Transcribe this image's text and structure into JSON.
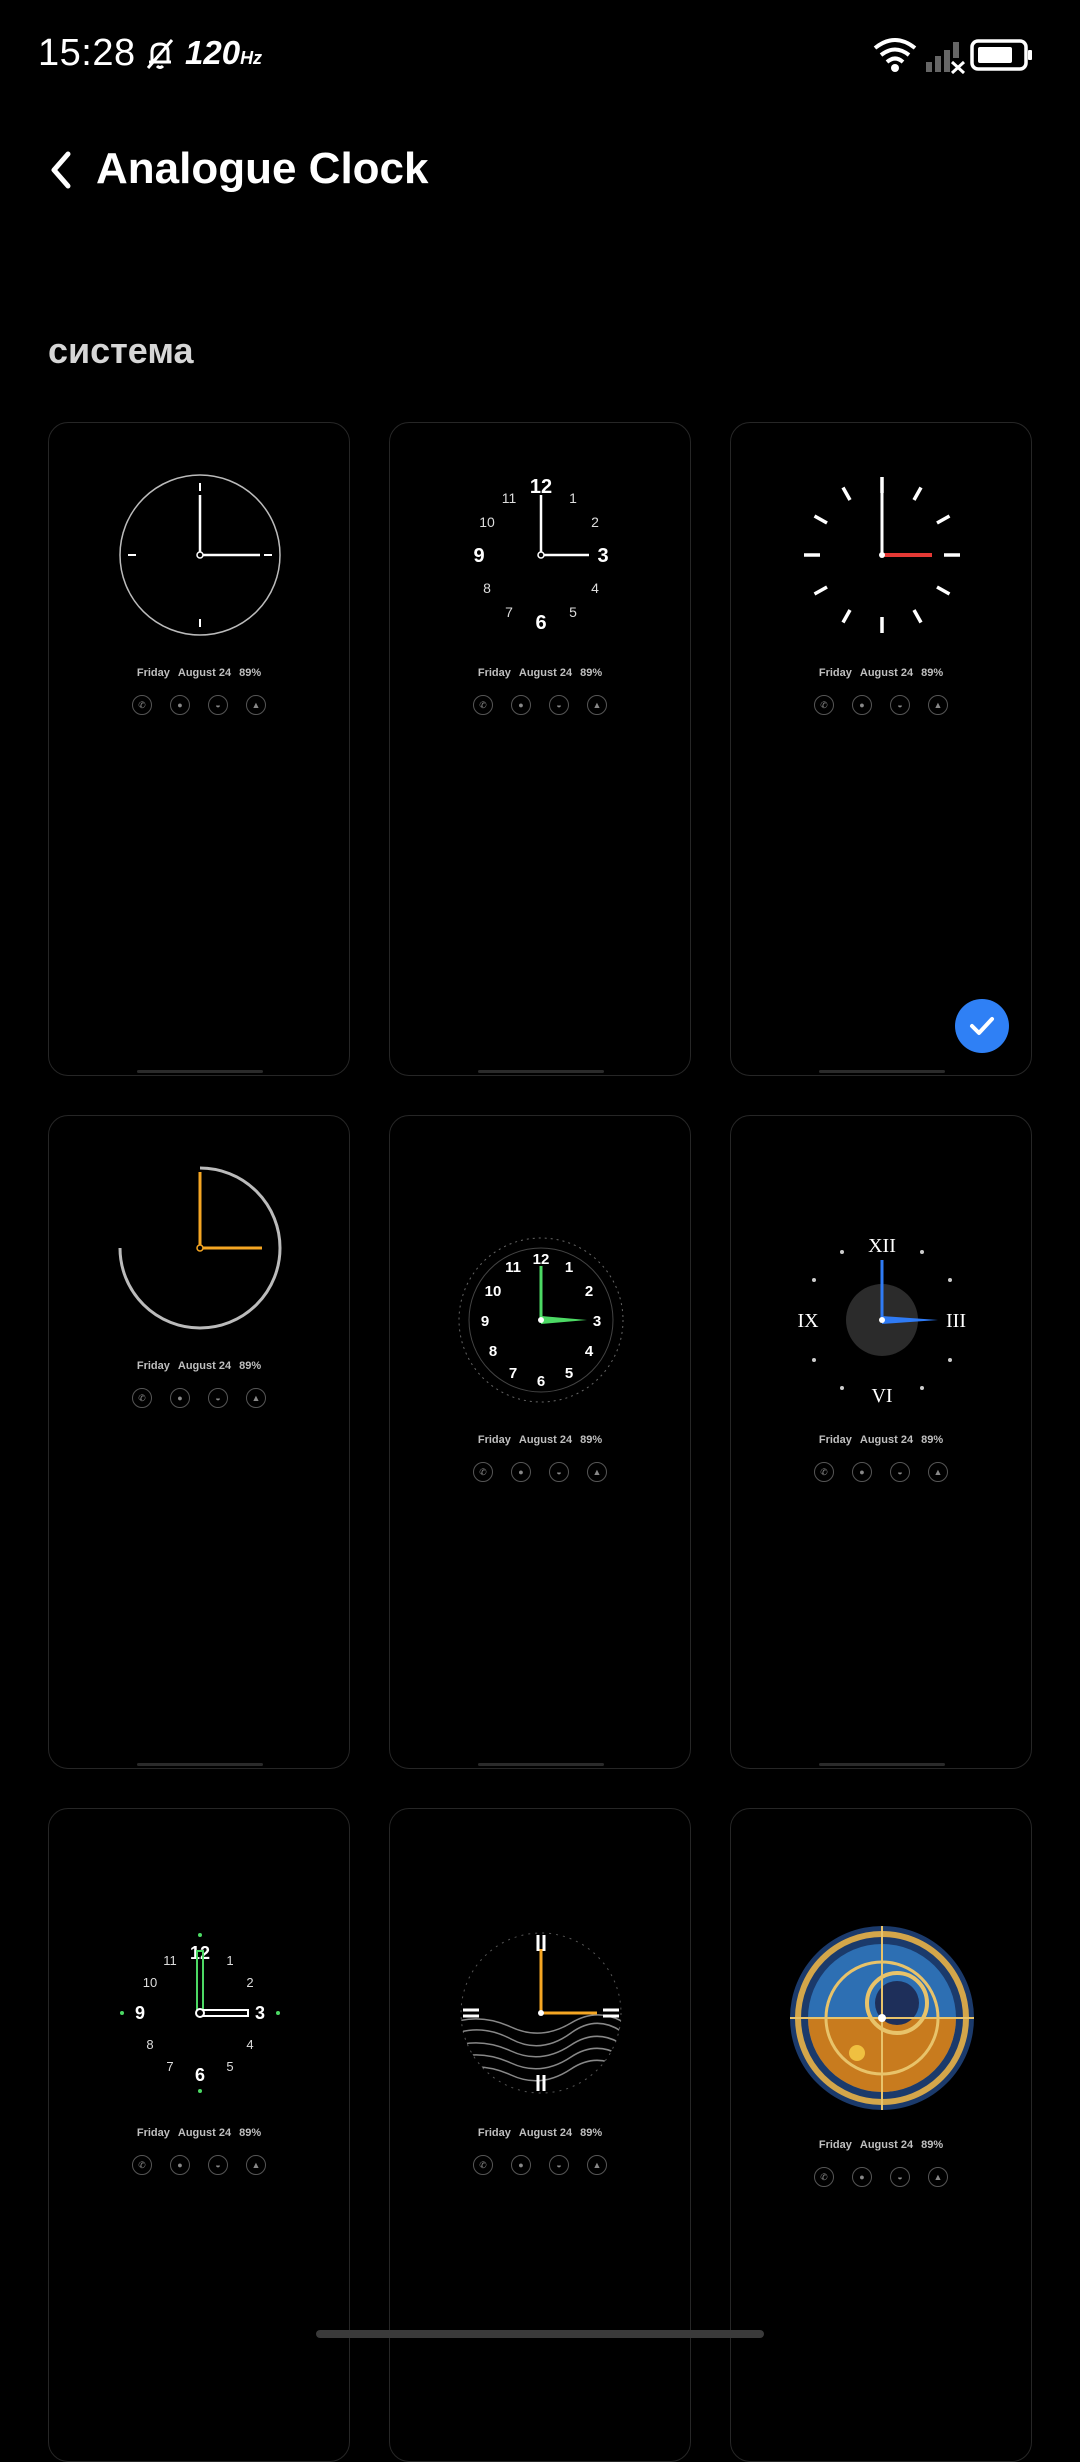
{
  "status_bar": {
    "time": "15:28",
    "refresh_rate": "120",
    "refresh_unit": "Hz",
    "icons": [
      "mute-bell-icon",
      "wifi-icon",
      "cellular-signal-icon",
      "battery-icon"
    ]
  },
  "header": {
    "back_icon": "chevron-left-icon",
    "title": "Analogue Clock"
  },
  "section": {
    "label": "система"
  },
  "card_info": {
    "day": "Friday",
    "date": "August 24",
    "battery": "89%"
  },
  "selected_card": 3,
  "colors": {
    "background": "#000000",
    "accent_check": "#2f80f5",
    "hand_red": "#e53935",
    "hand_orange": "#f5a623",
    "hand_green": "#4cd964",
    "hand_blue": "#2f7bf5"
  },
  "clocks": [
    {
      "style": "thin-ring-white"
    },
    {
      "style": "numerals-white",
      "numerals": [
        "12",
        "1",
        "2",
        "3",
        "4",
        "5",
        "6",
        "7",
        "8",
        "9",
        "10",
        "11"
      ]
    },
    {
      "style": "bold-ticks-red"
    },
    {
      "style": "arc-orange"
    },
    {
      "style": "sport-green",
      "numerals": [
        "12",
        "1",
        "2",
        "3",
        "4",
        "5",
        "6",
        "7",
        "8",
        "9",
        "10",
        "11"
      ]
    },
    {
      "style": "roman-blue",
      "numerals": [
        "XII",
        "III",
        "VI",
        "IX"
      ]
    },
    {
      "style": "numerals-green",
      "numerals": [
        "12",
        "1",
        "2",
        "3",
        "4",
        "5",
        "6",
        "7",
        "8",
        "9",
        "10",
        "11"
      ]
    },
    {
      "style": "waves-orange"
    },
    {
      "style": "astronomical"
    }
  ]
}
